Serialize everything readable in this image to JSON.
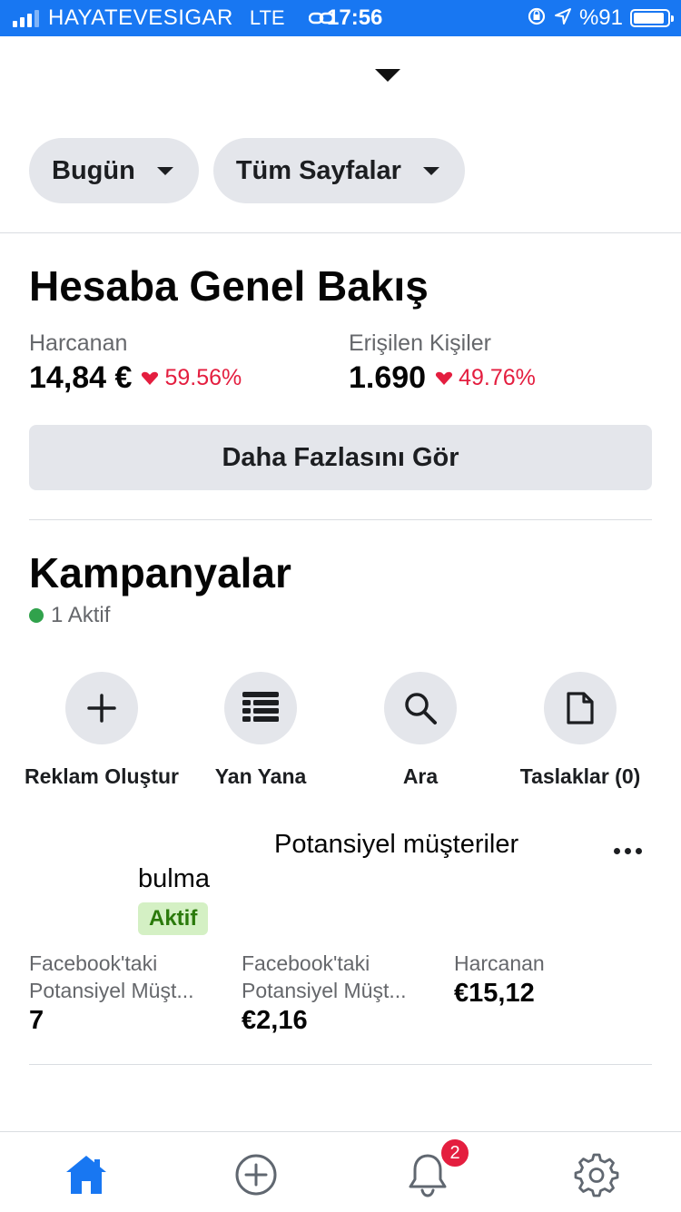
{
  "status_bar": {
    "carrier": "HAYATEVESIGAR",
    "network": "LTE",
    "time": "17:56",
    "battery_percent": "%91",
    "battery_level": 0.91
  },
  "filters": [
    {
      "label": "Bugün"
    },
    {
      "label": "Tüm Sayfalar"
    }
  ],
  "overview": {
    "title": "Hesaba Genel Bakış",
    "metrics": [
      {
        "label": "Harcanan",
        "value": "14,84 €",
        "change": "59.56%"
      },
      {
        "label": "Erişilen Kişiler",
        "value": "1.690",
        "change": "49.76%"
      }
    ],
    "more_button": "Daha Fazlasını Gör"
  },
  "campaigns": {
    "title": "Kampanyalar",
    "active_count": "1 Aktif",
    "actions": [
      {
        "label": "Reklam Oluştur",
        "icon": "plus-icon"
      },
      {
        "label": "Yan Yana",
        "icon": "list-icon"
      },
      {
        "label": "Ara",
        "icon": "search-icon"
      },
      {
        "label": "Taslaklar (0)",
        "icon": "draft-icon"
      }
    ],
    "item": {
      "name_line1": "Potansiyel müşteriler",
      "name_line2": "bulma",
      "status": "Aktif",
      "stats": [
        {
          "label_line1": "Facebook'taki",
          "label_line2": "Potansiyel Müşt...",
          "value": "7"
        },
        {
          "label_line1": "Facebook'taki",
          "label_line2": "Potansiyel Müşt...",
          "value": "€2,16"
        },
        {
          "label_line1": "Harcanan",
          "label_line2": "",
          "value": "€15,12"
        }
      ]
    }
  },
  "tab_bar": {
    "tabs": [
      "home-icon",
      "add-circle-icon",
      "bell-icon",
      "settings-gear-icon"
    ],
    "notification_count": "2"
  },
  "colors": {
    "brand_blue": "#1877f2",
    "decline_red": "#e41e3f",
    "active_green": "#31a24c"
  }
}
